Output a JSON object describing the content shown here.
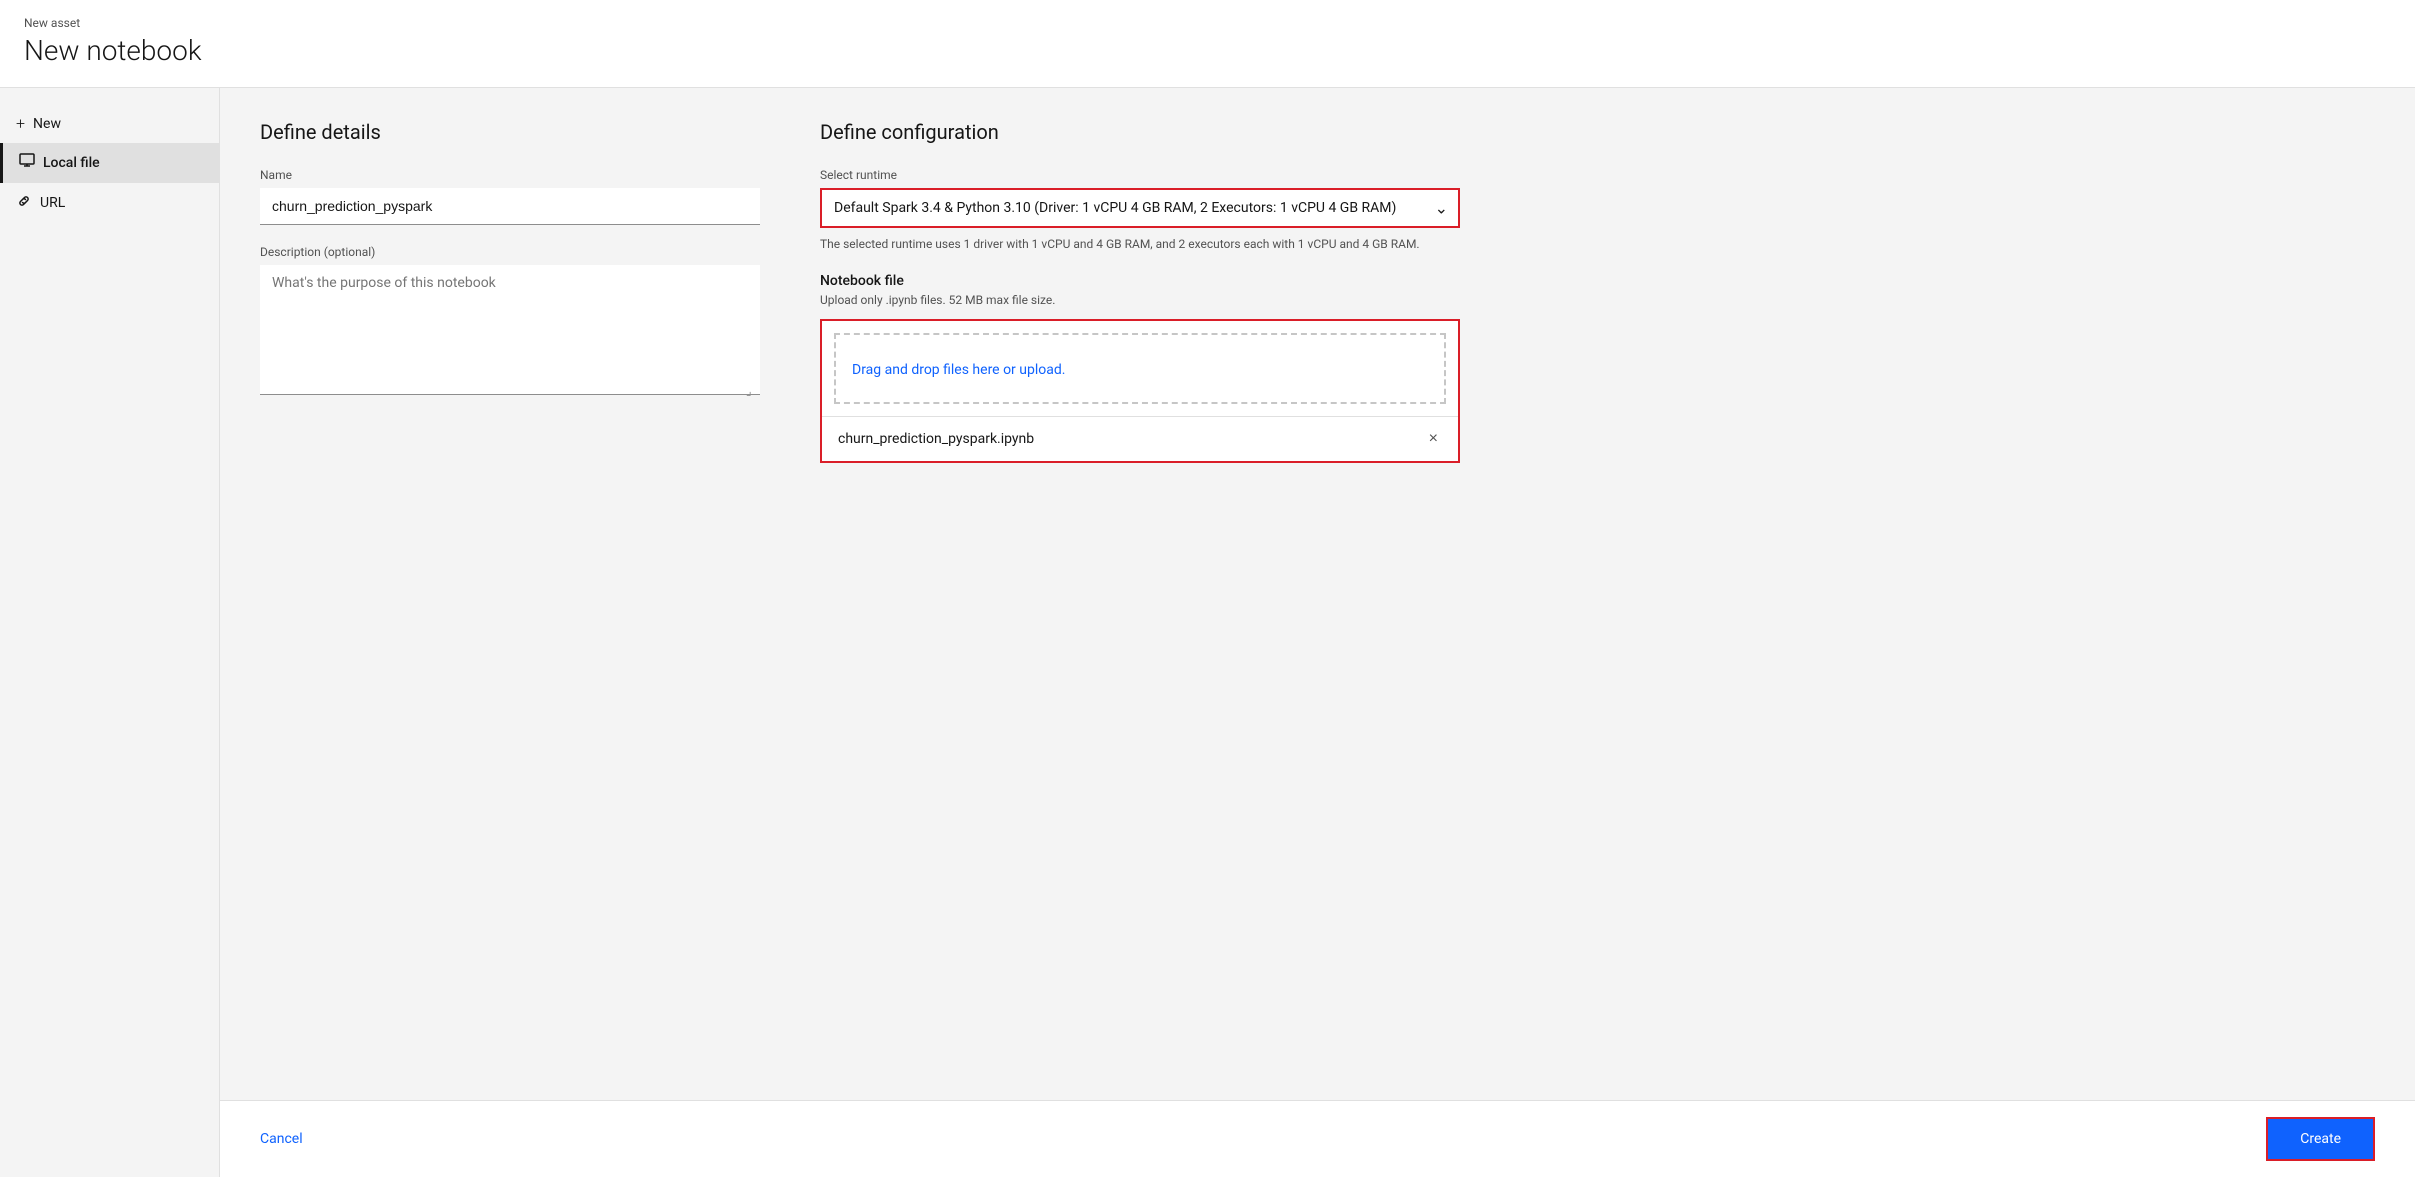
{
  "header": {
    "breadcrumb": "New asset",
    "title": "New notebook"
  },
  "sidebar": {
    "new_label": "New",
    "items": [
      {
        "id": "local-file",
        "label": "Local file",
        "active": true,
        "icon": "monitor-icon"
      },
      {
        "id": "url",
        "label": "URL",
        "active": false,
        "icon": "link-icon"
      }
    ]
  },
  "details": {
    "section_title": "Define details",
    "name_label": "Name",
    "name_value": "churn_prediction_pyspark",
    "description_label": "Description (optional)",
    "description_placeholder": "What's the purpose of this notebook"
  },
  "configuration": {
    "section_title": "Define configuration",
    "runtime_label": "Select runtime",
    "runtime_value": "Default Spark 3.4 & Python 3.10 (Driver: 1 vCPU 4 GB RAM, 2 Executors: 1 vCPU 4 GB RAM)",
    "runtime_hint": "The selected runtime uses 1 driver with 1 vCPU and 4 GB RAM, and 2 executors each with 1 vCPU and 4 GB RAM.",
    "notebook_file_label": "Notebook file",
    "notebook_file_hint": "Upload only .ipynb files. 52 MB max file size.",
    "upload_text": "Drag and drop files here or upload.",
    "uploaded_file_name": "churn_prediction_pyspark.ipynb",
    "remove_label": "×"
  },
  "footer": {
    "cancel_label": "Cancel",
    "create_label": "Create"
  }
}
